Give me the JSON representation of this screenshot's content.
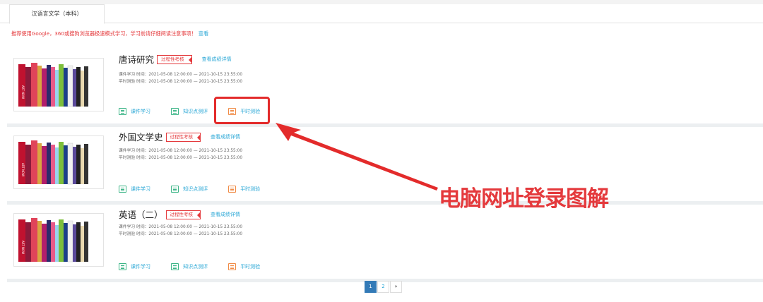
{
  "tabs": [
    {
      "label": "汉语言文学（本科）"
    }
  ],
  "notice": {
    "text": "推荐使用Google，360或搜狗浏览器极速模式学习，学习前请仔细阅读注意事项！",
    "link": "查看"
  },
  "courses": [
    {
      "title": "唐诗研究",
      "tag": "过程性考核",
      "score_link": "查看成绩详情",
      "study_time": "课件学习 时间：2021-05-08 12:00:00 — 2021-10-15 23:55:00",
      "test_time": "平时测验 时间：2021-05-08 12:00:00 — 2021-10-15 23:55:00",
      "actions": [
        "课件学习",
        "知识点测评",
        "平时测验"
      ]
    },
    {
      "title": "外国文学史",
      "tag": "过程性考核",
      "score_link": "查看成绩详情",
      "study_time": "课件学习 时间：2021-05-08 12:00:00 — 2021-10-15 23:55:00",
      "test_time": "平时测验 时间：2021-05-08 12:00:00 — 2021-10-15 23:55:00",
      "actions": [
        "课件学习",
        "知识点测评",
        "平时测验"
      ]
    },
    {
      "title": "英语（二）",
      "tag": "过程性考核",
      "score_link": "查看成绩详情",
      "study_time": "课件学习 时间：2021-05-08 12:00:00 — 2021-10-15 23:55:00",
      "test_time": "平时测验 时间：2021-05-08 12:00:00 — 2021-10-15 23:55:00",
      "actions": [
        "课件学习",
        "知识点测评",
        "平时测验"
      ]
    }
  ],
  "annotation": "电脑网址登录图解",
  "pagination": {
    "pages": [
      "1",
      "2"
    ],
    "next": "»",
    "current": "1"
  },
  "colors": {
    "accent_red": "#e4393c",
    "link_blue": "#2aa7d6",
    "active_page": "#337ab7"
  },
  "icons": {
    "action": "document-icon"
  }
}
